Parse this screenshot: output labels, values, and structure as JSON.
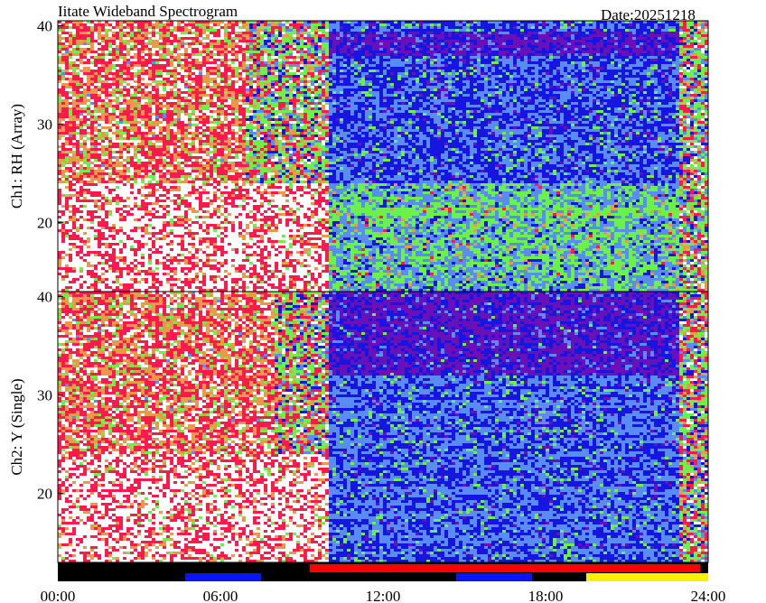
{
  "title": "Iitate Wideband Spectrogram",
  "date_label": "Date:20251218",
  "chart_data": [
    {
      "type": "heatmap",
      "name": "Ch1: RH (Array)",
      "ylabel": "Ch1: RH (Array)",
      "xlabel": "",
      "y_ticks": [
        20,
        30,
        40
      ],
      "x_range_hours": [
        0,
        24
      ],
      "y_range_mhz": [
        13,
        40.5
      ],
      "palette": [
        "#ffffff",
        "#ff1a4d",
        "#e89a4a",
        "#6af24a",
        "#5a8cf5",
        "#1616e0",
        "#6a10b8"
      ],
      "regions": [
        {
          "t0": 0,
          "t1": 7,
          "f0": 24,
          "f1": 40.5,
          "level": "high"
        },
        {
          "t0": 0,
          "t1": 10,
          "f0": 13,
          "f1": 24,
          "level": "saturated"
        },
        {
          "t0": 7,
          "t1": 10,
          "f0": 24,
          "f1": 40.5,
          "level": "medium-high"
        },
        {
          "t0": 10,
          "t1": 23,
          "f0": 24,
          "f1": 40.5,
          "level": "low"
        },
        {
          "t0": 10,
          "t1": 23,
          "f0": 13,
          "f1": 24,
          "level": "medium"
        },
        {
          "t0": 23,
          "t1": 24,
          "f0": 13,
          "f1": 40.5,
          "level": "medium-high"
        }
      ]
    },
    {
      "type": "heatmap",
      "name": "Ch2: Y (Single)",
      "ylabel": "Ch2: Y (Single)",
      "xlabel": "",
      "y_ticks": [
        20,
        30,
        40
      ],
      "x_range_hours": [
        0,
        24
      ],
      "y_range_mhz": [
        13,
        40.5
      ],
      "palette": [
        "#ffffff",
        "#ff1a4d",
        "#e89a4a",
        "#6af24a",
        "#5a8cf5",
        "#1616e0",
        "#6a10b8"
      ],
      "regions": [
        {
          "t0": 0,
          "t1": 8,
          "f0": 24,
          "f1": 40.5,
          "level": "high"
        },
        {
          "t0": 0,
          "t1": 10,
          "f0": 13,
          "f1": 24,
          "level": "saturated"
        },
        {
          "t0": 8,
          "t1": 10,
          "f0": 24,
          "f1": 40.5,
          "level": "medium-high"
        },
        {
          "t0": 10,
          "t1": 23,
          "f0": 32,
          "f1": 40.5,
          "level": "very-low"
        },
        {
          "t0": 10,
          "t1": 23,
          "f0": 13,
          "f1": 32,
          "level": "low-banded"
        },
        {
          "t0": 23,
          "t1": 24,
          "f0": 13,
          "f1": 40.5,
          "level": "medium-high"
        }
      ]
    }
  ],
  "time_axis": {
    "ticks": [
      "00:00",
      "06:00",
      "12:00",
      "18:00",
      "24:00"
    ],
    "tick_hours": [
      0,
      6,
      12,
      18,
      24
    ]
  },
  "status_bar": {
    "background": "#000000",
    "segments": [
      {
        "start_hour": 4.7,
        "end_hour": 7.5,
        "color": "#0a14ff",
        "row": "lower"
      },
      {
        "start_hour": 9.3,
        "end_hour": 23.7,
        "color": "#ff0000",
        "row": "upper"
      },
      {
        "start_hour": 14.7,
        "end_hour": 17.5,
        "color": "#0a14ff",
        "row": "lower"
      },
      {
        "start_hour": 19.5,
        "end_hour": 24,
        "color": "#ffee00",
        "row": "lower"
      }
    ]
  }
}
